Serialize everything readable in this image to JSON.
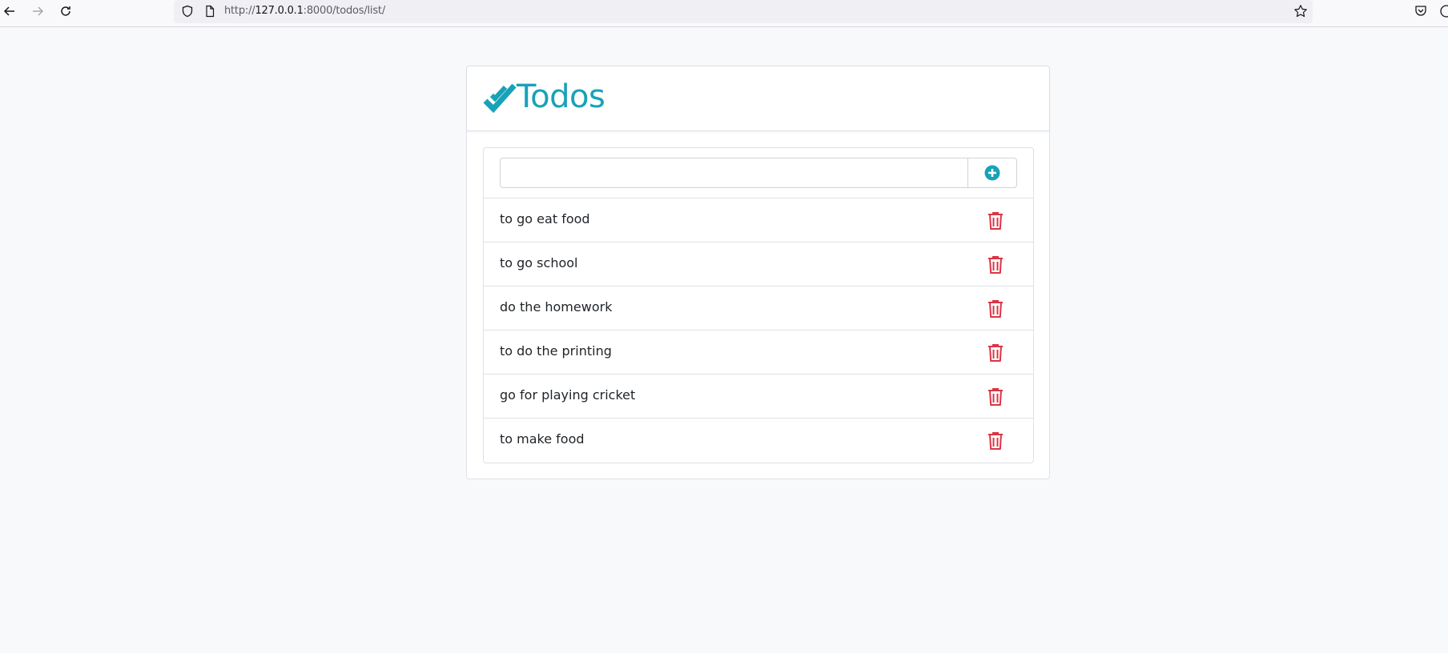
{
  "browser": {
    "url_prefix": "http://",
    "url_host": "127.0.0.1",
    "url_rest": ":8000/todos/list/"
  },
  "app": {
    "title": "Todos",
    "accent_color": "#17a2b8",
    "delete_color": "#dc3545"
  },
  "add_form": {
    "input_value": "",
    "add_icon": "plus-circle-icon"
  },
  "todos": [
    {
      "text": "to go eat food"
    },
    {
      "text": "to go school"
    },
    {
      "text": "do the homework"
    },
    {
      "text": "to do the printing"
    },
    {
      "text": "go for playing cricket"
    },
    {
      "text": "to make food"
    }
  ]
}
